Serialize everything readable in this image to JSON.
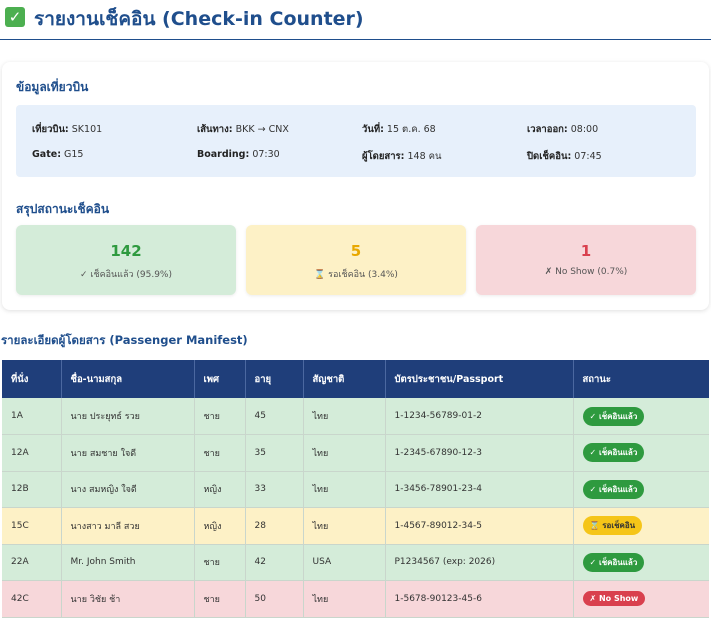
{
  "header": {
    "icon": "check-box-icon",
    "title": "รายงานเช็คอิน (Check-in Counter)"
  },
  "flight_section": {
    "title": "ข้อมูลเที่ยวบิน"
  },
  "flight_info": [
    {
      "label": "เที่ยวบิน:",
      "value": "SK101"
    },
    {
      "label": "เส้นทาง:",
      "value": "BKK → CNX"
    },
    {
      "label": "วันที่:",
      "value": "15 ต.ค. 68"
    },
    {
      "label": "เวลาออก:",
      "value": "08:00"
    },
    {
      "label": "Gate:",
      "value": "G15"
    },
    {
      "label": "Boarding:",
      "value": "07:30"
    },
    {
      "label": "ผู้โดยสาร:",
      "value": "148 คน"
    },
    {
      "label": "ปิดเช็คอิน:",
      "value": "07:45"
    }
  ],
  "summary_section": {
    "title": "สรุปสถานะเช็คอิน"
  },
  "summary": {
    "checked": {
      "count": "142",
      "label": "✓ เช็คอินแล้ว (95.9%)",
      "color": "#2e9a3f"
    },
    "waiting": {
      "count": "5",
      "label": "⌛ รอเช็คอิน (3.4%)",
      "color": "#e8a800"
    },
    "noshow": {
      "count": "1",
      "label": "✗ No Show (0.7%)",
      "color": "#d9404e"
    }
  },
  "manifest": {
    "title": "รายละเอียดผู้โดยสาร (Passenger Manifest)",
    "columns": [
      "ที่นั่ง",
      "ชื่อ-นามสกุล",
      "เพศ",
      "อายุ",
      "สัญชาติ",
      "บัตรประชาชน/Passport",
      "สถานะ"
    ],
    "rows": [
      {
        "seat": "1A",
        "name": "นาย ประยุทธ์ รวย",
        "gender": "ชาย",
        "age": "45",
        "nationality": "ไทย",
        "id": "1-1234-56789-01-2",
        "status": "✓ เช็คอินแล้ว"
      },
      {
        "seat": "12A",
        "name": "นาย สมชาย ใจดี",
        "gender": "ชาย",
        "age": "35",
        "nationality": "ไทย",
        "id": "1-2345-67890-12-3",
        "status": "✓ เช็คอินแล้ว"
      },
      {
        "seat": "12B",
        "name": "นาง สมหญิง ใจดี",
        "gender": "หญิง",
        "age": "33",
        "nationality": "ไทย",
        "id": "1-3456-78901-23-4",
        "status": "✓ เช็คอินแล้ว"
      },
      {
        "seat": "15C",
        "name": "นางสาว มาลี สวย",
        "gender": "หญิง",
        "age": "28",
        "nationality": "ไทย",
        "id": "1-4567-89012-34-5",
        "status": "⌛ รอเช็คอิน"
      },
      {
        "seat": "22A",
        "name": "Mr. John Smith",
        "gender": "ชาย",
        "age": "42",
        "nationality": "USA",
        "id": "P1234567 (exp: 2026)",
        "status": "✓ เช็คอินแล้ว"
      },
      {
        "seat": "42C",
        "name": "นาย วิชัย ช้า",
        "gender": "ชาย",
        "age": "50",
        "nationality": "ไทย",
        "id": "1-5678-90123-45-6",
        "status": "✗ No Show"
      }
    ]
  }
}
